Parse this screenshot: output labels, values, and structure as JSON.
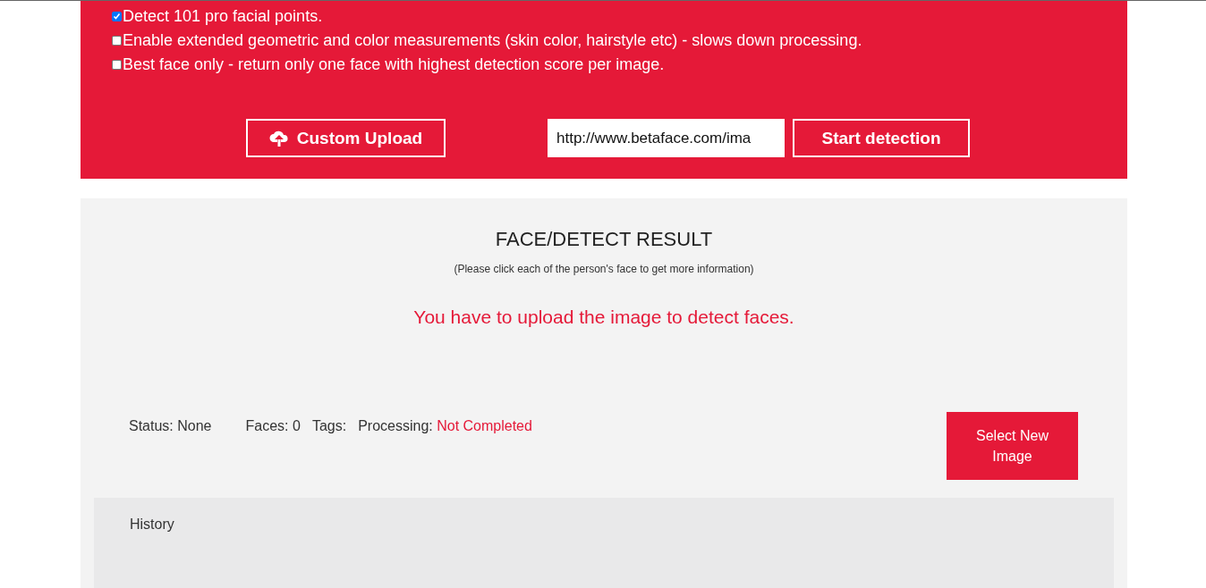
{
  "options": [
    {
      "label": "Detect 101 pro facial points.",
      "checked": true
    },
    {
      "label": "Enable extended geometric and color measurements (skin color, hairstyle etc) - slows down processing.",
      "checked": false
    },
    {
      "label": "Best face only - return only one face with highest detection score per image.",
      "checked": false
    }
  ],
  "upload_button": "Custom Upload",
  "url_field": {
    "value": "http://www.betaface.com/ima"
  },
  "start_button": "Start detection",
  "result": {
    "title": "FACE/DETECT RESULT",
    "hint": "(Please click each of the person's face to get more information)",
    "message": "You have to upload the image to detect faces.",
    "stats": [
      {
        "label": "Status:",
        "value": "None",
        "kind": "plain"
      },
      {
        "label": "Faces:",
        "value": "0",
        "kind": "plain"
      },
      {
        "label": "Tags:",
        "kind": "plain"
      },
      {
        "label": "Processing:",
        "value": "Not Completed",
        "kind": "alert"
      }
    ],
    "select_button": "Select New Image"
  },
  "history": {
    "title": "History"
  }
}
